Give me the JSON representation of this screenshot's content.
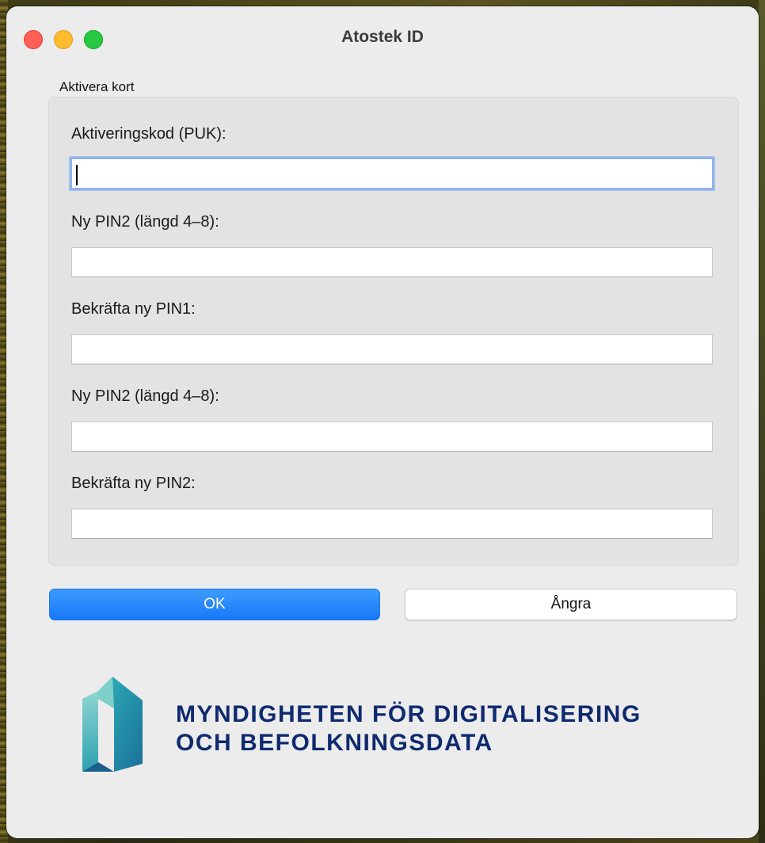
{
  "window": {
    "title": "Atostek ID"
  },
  "group": {
    "label": "Aktivera kort"
  },
  "fields": [
    {
      "label": "Aktiveringskod (PUK):",
      "value": "",
      "placeholder": ""
    },
    {
      "label": "Ny PIN2 (längd 4–8):",
      "value": "",
      "placeholder": ""
    },
    {
      "label": "Bekräfta ny PIN1:",
      "value": "",
      "placeholder": ""
    },
    {
      "label": "Ny PIN2 (längd 4–8):",
      "value": "",
      "placeholder": ""
    },
    {
      "label": "Bekräfta ny PIN2:",
      "value": "",
      "placeholder": ""
    }
  ],
  "buttons": {
    "ok_label": "OK",
    "cancel_label": "Ångra"
  },
  "branding": {
    "org_line1": "MYNDIGHETEN FÖR DIGITALISERING",
    "org_line2": "OCH BEFOLKNINGSDATA",
    "logo_icon": "dvv-logo-icon"
  },
  "colors": {
    "accent_blue": "#1879f7",
    "org_text": "#0f2a6e",
    "logo_teal": "#1f9aa6"
  }
}
